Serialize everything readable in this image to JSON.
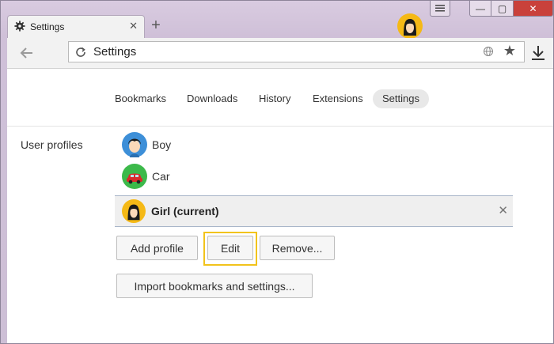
{
  "tab": {
    "title": "Settings",
    "icon": "gear-icon",
    "close": "✕"
  },
  "new_tab": "+",
  "window_controls": {
    "minimize": "—",
    "maximize": "▢",
    "close": "✕"
  },
  "omnibox": {
    "url": "Settings"
  },
  "nav": {
    "items": [
      {
        "label": "Bookmarks",
        "active": false
      },
      {
        "label": "Downloads",
        "active": false
      },
      {
        "label": "History",
        "active": false
      },
      {
        "label": "Extensions",
        "active": false
      },
      {
        "label": "Settings",
        "active": true
      }
    ]
  },
  "profiles": {
    "section_label": "User profiles",
    "items": [
      {
        "name": "Boy",
        "avatar": "boy-avatar"
      },
      {
        "name": "Car",
        "avatar": "car-avatar"
      }
    ],
    "current": {
      "name": "Girl (current)",
      "avatar": "girl-avatar",
      "remove": "✕"
    }
  },
  "buttons": {
    "add_profile": "Add profile",
    "edit": "Edit",
    "remove": "Remove...",
    "import": "Import bookmarks and settings..."
  },
  "colors": {
    "window_frame": "#cfc0d8",
    "selected_row_bg": "#efefef",
    "highlight": "#f2c31b",
    "close_button": "#c9413b"
  }
}
